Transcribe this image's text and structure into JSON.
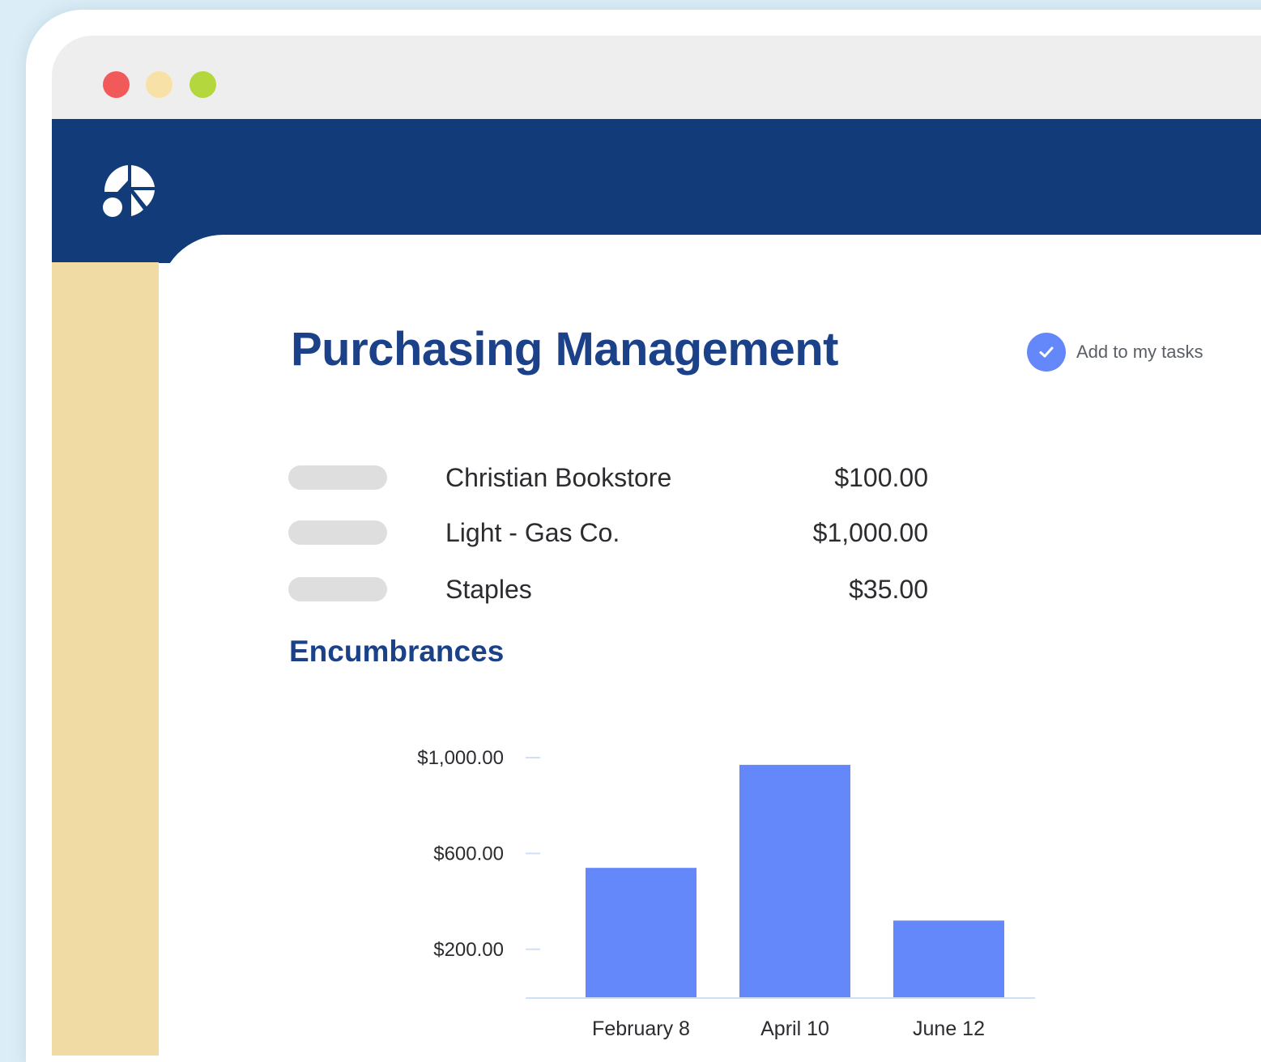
{
  "colors": {
    "background": "#dbedf6",
    "navbar": "#123b7a",
    "sidebar": "#f0dba5",
    "accent": "#6487fa",
    "title": "#1b4189",
    "dot_red": "#f25a5a",
    "dot_yellow": "#f7e1a6",
    "dot_green": "#b3d73d"
  },
  "window": {
    "controls": [
      "close",
      "minimize",
      "maximize"
    ]
  },
  "header": {
    "logo_icon": "pie-chart-logo-icon"
  },
  "page": {
    "title": "Purchasing Management",
    "task_button_label": "Add to my tasks",
    "task_button_icon": "checkmark-icon"
  },
  "purchases": [
    {
      "vendor": "Christian Bookstore",
      "amount": "$100.00"
    },
    {
      "vendor": "Light - Gas Co.",
      "amount": "$1,000.00"
    },
    {
      "vendor": "Staples",
      "amount": "$35.00"
    }
  ],
  "encumbrances": {
    "title": "Encumbrances"
  },
  "chart_data": {
    "type": "bar",
    "title": "Encumbrances",
    "xlabel": "",
    "ylabel": "",
    "categories": [
      "February 8",
      "April 10",
      "June 12"
    ],
    "values": [
      540,
      970,
      320
    ],
    "ylim": [
      0,
      1000
    ],
    "yticks": [
      1000,
      600,
      200
    ],
    "ytick_labels": [
      "$1,000.00",
      "$600.00",
      "$200.00"
    ],
    "grid": false,
    "legend": "none",
    "bar_color": "#6487fa"
  }
}
